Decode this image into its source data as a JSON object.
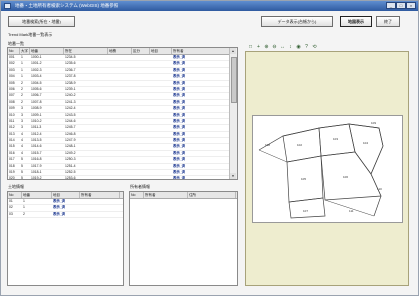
{
  "window": {
    "title": "地番・土地所有者検索システム (WebGIS) 地番参照",
    "min_glyph": "_",
    "max_glyph": "□",
    "close_glyph": "×"
  },
  "toolbar": {
    "btn_search": "地番検索(所在・地番)",
    "btn_table": "データ表示(台帳から)",
    "btn_map": "地図表示",
    "btn_close": "終了"
  },
  "section_label": "Trend Mark地番一覧表示",
  "main_list": {
    "caption": "地番一覧",
    "columns": [
      "No",
      "大字",
      "地番",
      "所在",
      "地積",
      "区分",
      "地目",
      "所有者"
    ],
    "rows": [
      [
        "001",
        "1",
        "1000-1",
        "1234-5",
        "",
        "",
        "",
        "表示_済"
      ],
      [
        "002",
        "1",
        "1001-2",
        "1235-6",
        "",
        "",
        "",
        "表示_済"
      ],
      [
        "003",
        "1",
        "1002-3",
        "1236-7",
        "",
        "",
        "",
        "表示_済"
      ],
      [
        "004",
        "1",
        "1003-4",
        "1237-8",
        "",
        "",
        "",
        "表示_済"
      ],
      [
        "005",
        "2",
        "1004-5",
        "1238-9",
        "",
        "",
        "",
        "表示_済"
      ],
      [
        "006",
        "2",
        "1005-6",
        "1239-1",
        "",
        "",
        "",
        "表示_済"
      ],
      [
        "007",
        "2",
        "1006-7",
        "1240-2",
        "",
        "",
        "",
        "表示_済"
      ],
      [
        "008",
        "2",
        "1007-8",
        "1241-3",
        "",
        "",
        "",
        "表示_済"
      ],
      [
        "009",
        "3",
        "1008-9",
        "1242-4",
        "",
        "",
        "",
        "表示_済"
      ],
      [
        "010",
        "3",
        "1009-1",
        "1243-5",
        "",
        "",
        "",
        "表示_済"
      ],
      [
        "011",
        "3",
        "1010-2",
        "1244-6",
        "",
        "",
        "",
        "表示_済"
      ],
      [
        "012",
        "3",
        "1011-3",
        "1245-7",
        "",
        "",
        "",
        "表示_済"
      ],
      [
        "013",
        "4",
        "1012-4",
        "1246-8",
        "",
        "",
        "",
        "表示_済"
      ],
      [
        "014",
        "4",
        "1013-5",
        "1247-9",
        "",
        "",
        "",
        "表示_済"
      ],
      [
        "015",
        "4",
        "1014-6",
        "1248-1",
        "",
        "",
        "",
        "表示_済"
      ],
      [
        "016",
        "4",
        "1015-7",
        "1249-2",
        "",
        "",
        "",
        "表示_済"
      ],
      [
        "017",
        "5",
        "1016-8",
        "1250-3",
        "",
        "",
        "",
        "表示_済"
      ],
      [
        "018",
        "5",
        "1017-9",
        "1251-4",
        "",
        "",
        "",
        "表示_済"
      ],
      [
        "019",
        "5",
        "1018-1",
        "1252-5",
        "",
        "",
        "",
        "表示_済"
      ],
      [
        "020",
        "5",
        "1019-2",
        "1253-6",
        "",
        "",
        "",
        "表示_済"
      ],
      [
        "021",
        "6",
        "1020-3",
        "1254-7",
        "",
        "",
        "",
        "表示_済"
      ],
      [
        "022",
        "6",
        "1021-4",
        "1255-8",
        "",
        "",
        "",
        "表示_済"
      ],
      [
        "023",
        "6",
        "1022-5",
        "1256-9",
        "",
        "",
        "",
        "表示_済"
      ],
      [
        "024",
        "6",
        "1023-6",
        "1257-1",
        "",
        "",
        "",
        "表示_済"
      ],
      [
        "025",
        "7",
        "1024-7",
        "1258-2",
        "",
        "",
        "",
        "表示_済"
      ],
      [
        "026",
        "7",
        "1025-8",
        "1259-3",
        "",
        "",
        "",
        "表示_済"
      ]
    ]
  },
  "lower_left": {
    "caption": "土地情報",
    "columns": [
      "No",
      "地番",
      "地目",
      "所有者"
    ],
    "rows": [
      [
        "01",
        "1",
        "表示_済"
      ],
      [
        "02",
        "1",
        "表示_済"
      ],
      [
        "03",
        "2",
        "表示_済"
      ]
    ]
  },
  "lower_right": {
    "caption": "所有者情報",
    "columns": [
      "No",
      "所有者",
      "住所"
    ]
  },
  "map": {
    "tools": [
      "□",
      "+",
      "⊕",
      "⊖",
      "↔",
      "↕",
      "◉",
      "?",
      "⟲"
    ],
    "parcel_labels": [
      "102",
      "103",
      "104",
      "105",
      "106",
      "107",
      "108",
      "109",
      "110",
      "111"
    ]
  }
}
